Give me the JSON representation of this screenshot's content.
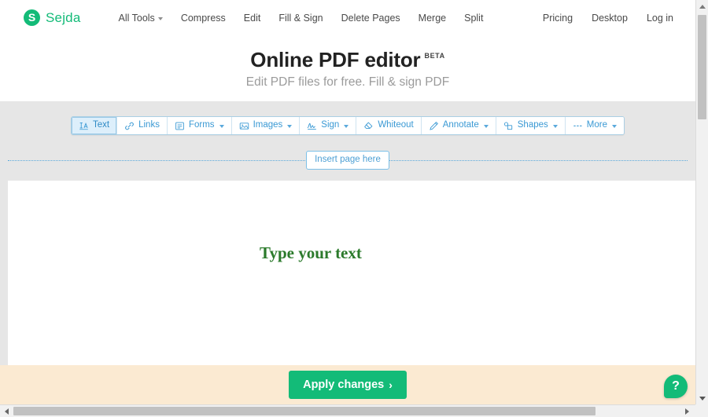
{
  "brand": {
    "logo_mark": "S",
    "logo_text": "Sejda",
    "accent_green": "#13bb78",
    "accent_blue": "#3a99d4"
  },
  "topnav": {
    "left_items": [
      {
        "label": "All Tools",
        "icon": "chevron-down-icon",
        "has_caret": true
      },
      {
        "label": "Compress",
        "has_caret": false
      },
      {
        "label": "Edit",
        "has_caret": false
      },
      {
        "label": "Fill & Sign",
        "has_caret": false
      },
      {
        "label": "Delete Pages",
        "has_caret": false
      },
      {
        "label": "Merge",
        "has_caret": false
      },
      {
        "label": "Split",
        "has_caret": false
      }
    ],
    "right_items": [
      {
        "label": "Pricing"
      },
      {
        "label": "Desktop"
      },
      {
        "label": "Log in"
      }
    ]
  },
  "hero": {
    "title": "Online PDF editor",
    "badge": "BETA",
    "subtitle": "Edit PDF files for free. Fill & sign PDF"
  },
  "toolbar": {
    "items": [
      {
        "label": "Text",
        "icon": "text-tool-icon",
        "caret": false,
        "active": true
      },
      {
        "label": "Links",
        "icon": "link-icon",
        "caret": false,
        "active": false
      },
      {
        "label": "Forms",
        "icon": "form-icon",
        "caret": true,
        "active": false
      },
      {
        "label": "Images",
        "icon": "image-icon",
        "caret": true,
        "active": false
      },
      {
        "label": "Sign",
        "icon": "signature-icon",
        "caret": true,
        "active": false
      },
      {
        "label": "Whiteout",
        "icon": "eraser-icon",
        "caret": false,
        "active": false
      },
      {
        "label": "Annotate",
        "icon": "pen-icon",
        "caret": true,
        "active": false
      },
      {
        "label": "Shapes",
        "icon": "shapes-icon",
        "caret": true,
        "active": false
      },
      {
        "label": "More",
        "icon": "ellipsis-icon",
        "caret": true,
        "active": false
      }
    ]
  },
  "page_divider": {
    "insert_label": "Insert page here"
  },
  "document": {
    "text_objects": [
      {
        "content": "Type your text",
        "color": "#2b7a2b"
      }
    ]
  },
  "action_bar": {
    "apply_label": "Apply changes",
    "apply_chevron": "›",
    "background": "#fbead2"
  },
  "help": {
    "glyph": "?",
    "name": "help-button"
  }
}
